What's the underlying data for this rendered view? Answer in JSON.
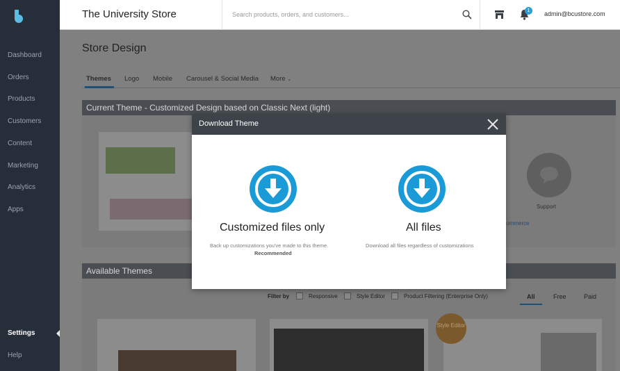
{
  "sidebar": {
    "items": [
      {
        "label": "Dashboard"
      },
      {
        "label": "Orders"
      },
      {
        "label": "Products"
      },
      {
        "label": "Customers"
      },
      {
        "label": "Content"
      },
      {
        "label": "Marketing"
      },
      {
        "label": "Analytics"
      },
      {
        "label": "Apps"
      }
    ],
    "bottom": [
      {
        "label": "Settings",
        "active": true
      },
      {
        "label": "Help"
      }
    ]
  },
  "header": {
    "store_title": "The University Store",
    "search_placeholder": "Search products, orders, and customers...",
    "notification_count": "1",
    "user_email": "admin@bcustore.com"
  },
  "page": {
    "title": "Store Design",
    "tabs": [
      "Themes",
      "Logo",
      "Mobile",
      "Carousel & Social Media",
      "More"
    ],
    "active_tab": "Themes",
    "current_theme_heading": "Current Theme - Customized Design based on Classic Next (light)",
    "support_label": "Support",
    "bc_link": "igcommerce",
    "available_themes_heading": "Available Themes",
    "filter_label": "Filter by",
    "filters": [
      "Responsive",
      "Style Editor",
      "Product Filtering (Enterprise Only)"
    ],
    "price_tabs": [
      "All",
      "Free",
      "Paid"
    ],
    "active_price_tab": "All",
    "style_badge": "Style Editor"
  },
  "modal": {
    "title": "Download Theme",
    "options": [
      {
        "title": "Customized files only",
        "description": "Back up customizations you've made to this theme.",
        "note": "Recommended"
      },
      {
        "title": "All files",
        "description": "Download all files regardless of customizations",
        "note": ""
      }
    ]
  },
  "colors": {
    "sidebar": "#262e3a",
    "accent": "#1a9bd7",
    "modal_header": "#3d4349",
    "overlay": "#808080"
  },
  "icons": [
    "logo-icon",
    "search-icon",
    "storefront-icon",
    "bell-icon",
    "close-icon",
    "download-icon",
    "chat-bubble-icon"
  ]
}
